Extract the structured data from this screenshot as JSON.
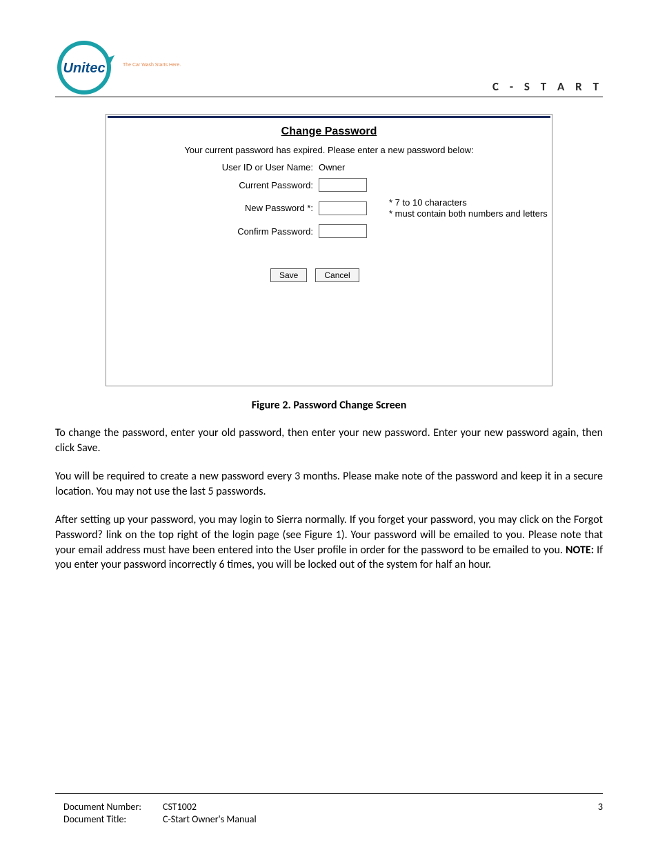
{
  "header": {
    "brand": "C - S T A R T",
    "logo_text": "Unitec",
    "tagline": "The Car Wash Starts Here."
  },
  "screenshot": {
    "title": "Change Password",
    "expired_msg": "Your current password has expired. Please enter a new password below:",
    "rows": {
      "user_label": "User ID or User Name:",
      "user_value": "Owner",
      "current_label": "Current Password:",
      "new_label": "New Password *:",
      "confirm_label": "Confirm Password:"
    },
    "hints": {
      "line1": "* 7 to 10 characters",
      "line2": "* must contain both numbers and letters"
    },
    "buttons": {
      "save": "Save",
      "cancel": "Cancel"
    }
  },
  "figure_caption": "Figure 2. Password Change Screen",
  "para1": "To change the password, enter your old password, then enter your new password. Enter your new password again, then click Save.",
  "para2": "You will be required to create a new password every 3 months. Please make note of the password and keep it in a secure location. You may not use the last 5 passwords.",
  "para3_a": "After setting up your password, you may login to Sierra normally. If you forget your password, you may click on the Forgot Password? link on the top right of the login page (see Figure 1). Your password will be emailed to you. Please note that your email address must have been entered into the User profile in order for the password to be emailed to you. ",
  "para3_note_label": "NOTE:",
  "para3_b": " If you enter your password incorrectly 6 times, you will be locked out of the system for half an hour.",
  "footer": {
    "doc_num_label": "Document Number:",
    "doc_num_value": "CST1002",
    "doc_title_label": "Document Title:",
    "doc_title_value": "C-Start Owner's Manual",
    "page_number": "3"
  }
}
